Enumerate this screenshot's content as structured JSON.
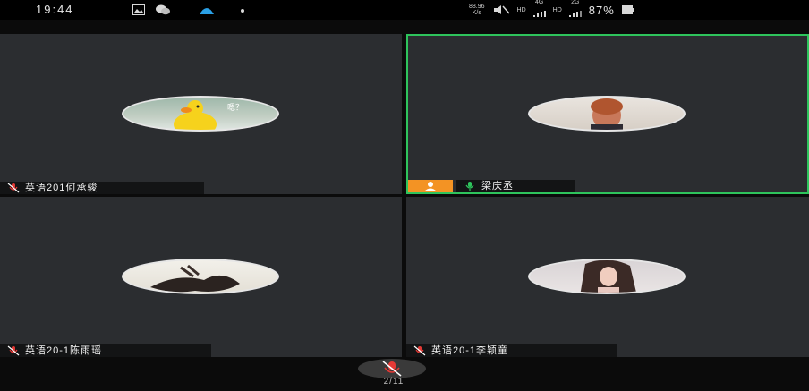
{
  "status_bar": {
    "time": "19:44",
    "speed_top": "88.96",
    "speed_bottom": "K/s",
    "signal_hd_1": "HD",
    "signal_4g": "4G",
    "signal_hd_2": "HD",
    "signal_2g": "2G",
    "battery": "87%"
  },
  "participants": [
    {
      "name": "英语201何承骏",
      "active": false,
      "mic": "muted"
    },
    {
      "name": "梁庆丞",
      "active": true,
      "mic": "on",
      "host": true
    },
    {
      "name": "英语20-1陈雨瑶",
      "active": false,
      "mic": "muted"
    },
    {
      "name": "英语20-1李颖童",
      "active": false,
      "mic": "muted"
    }
  ],
  "avatar_1_caption": "嗯？",
  "pagination": {
    "text": "2/11"
  },
  "colors": {
    "active_border": "#2ec45c",
    "host_badge": "#f39324",
    "tile_bg": "#2b2d30",
    "muted_mic": "#e53935",
    "active_mic": "#2ec45c"
  }
}
